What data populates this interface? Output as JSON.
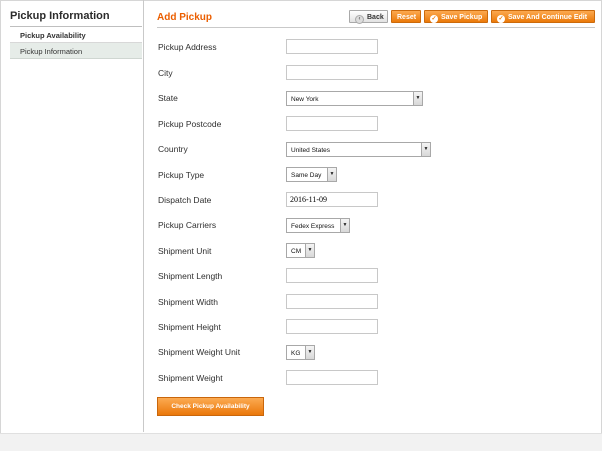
{
  "sidebar": {
    "title": "Pickup Information",
    "tab_head": "Pickup Availability",
    "tab_item": "Pickup Information"
  },
  "header": {
    "title": "Add Pickup",
    "buttons": {
      "back": "Back",
      "reset": "Reset",
      "save": "Save Pickup",
      "save_continue": "Save And Continue Edit"
    }
  },
  "form": {
    "pickup_address": {
      "label": "Pickup Address",
      "value": ""
    },
    "city": {
      "label": "City",
      "value": ""
    },
    "state": {
      "label": "State",
      "value": "New York"
    },
    "pickup_postcode": {
      "label": "Pickup Postcode",
      "value": ""
    },
    "country": {
      "label": "Country",
      "value": "United States"
    },
    "pickup_type": {
      "label": "Pickup Type",
      "value": "Same Day"
    },
    "dispatch_date": {
      "label": "Dispatch Date",
      "value": "2016-11-09"
    },
    "pickup_carriers": {
      "label": "Pickup Carriers",
      "value": "Fedex Express"
    },
    "shipment_unit": {
      "label": "Shipment Unit",
      "value": "CM"
    },
    "shipment_length": {
      "label": "Shipment Length",
      "value": ""
    },
    "shipment_width": {
      "label": "Shipment Width",
      "value": ""
    },
    "shipment_height": {
      "label": "Shipment Height",
      "value": ""
    },
    "shipment_weight_unit": {
      "label": "Shipment Weight Unit",
      "value": "KG"
    },
    "shipment_weight": {
      "label": "Shipment Weight",
      "value": ""
    },
    "check_button": "Check Pickup Availability"
  },
  "colors": {
    "accent": "#eb7a0a",
    "title": "#eb5e00",
    "sidebar_active": "#e6ece8"
  }
}
